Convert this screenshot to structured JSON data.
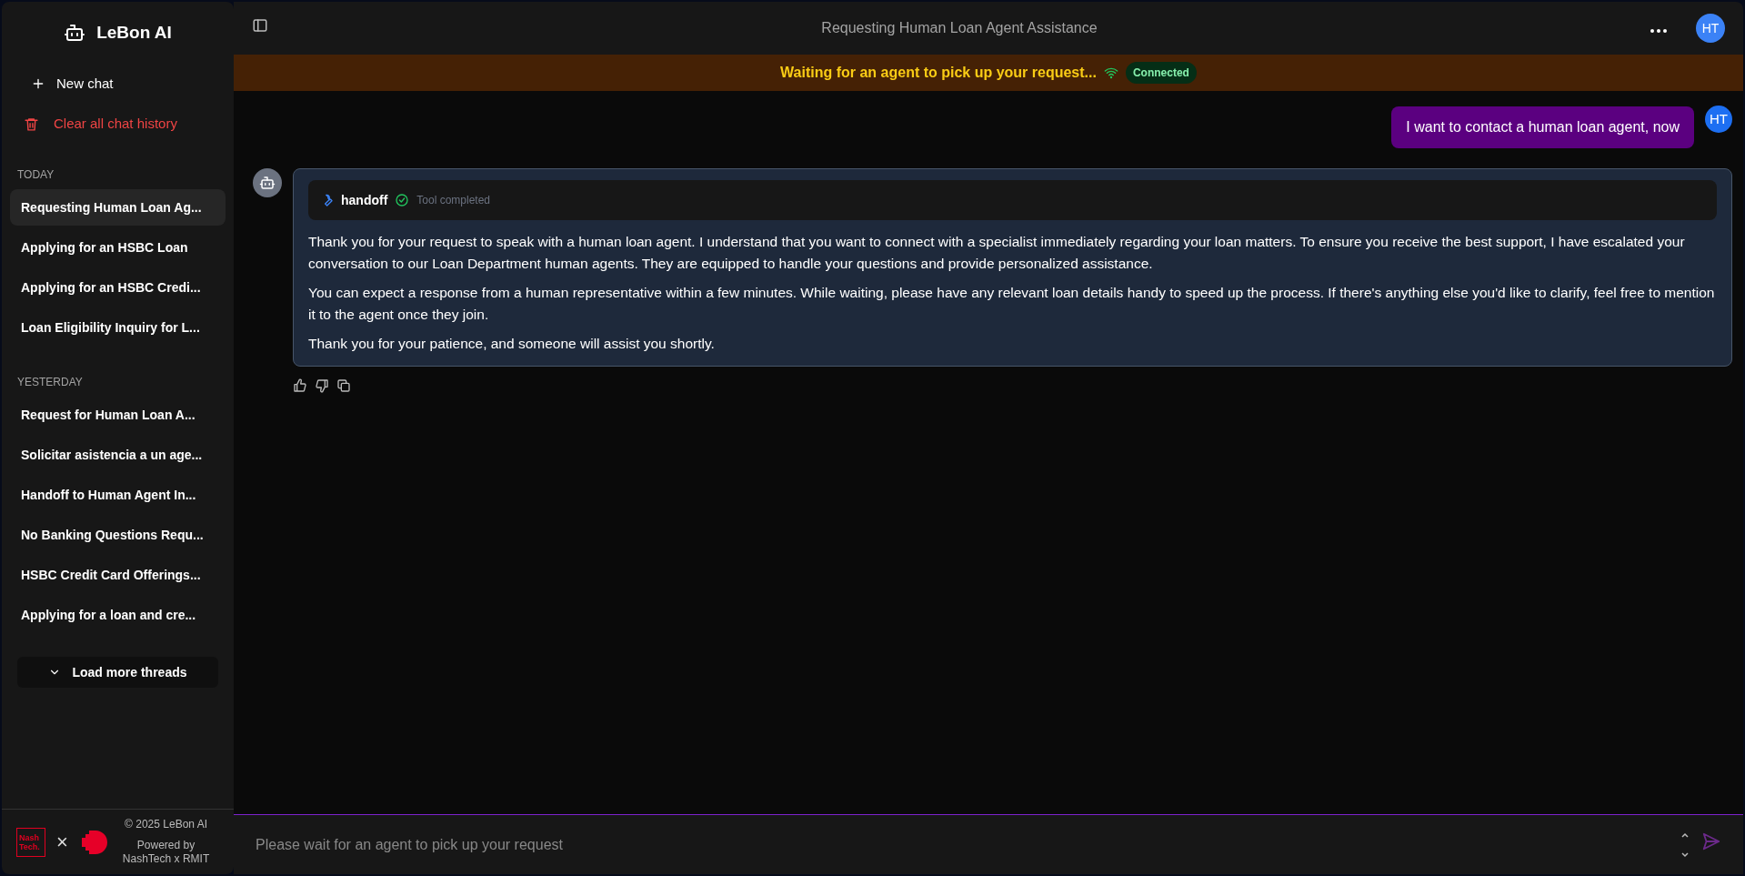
{
  "sidebar": {
    "brand": "LeBon AI",
    "actions": [
      {
        "kind": "new",
        "label": "New chat"
      },
      {
        "kind": "clear",
        "label": "Clear all chat history"
      }
    ],
    "groups": [
      {
        "label": "TODAY",
        "items": [
          {
            "title": "Requesting Human Loan Ag...",
            "selected": true
          },
          {
            "title": "Applying for an HSBC Loan",
            "selected": false
          },
          {
            "title": "Applying for an HSBC Credi...",
            "selected": false
          },
          {
            "title": "Loan Eligibility Inquiry for L...",
            "selected": false
          }
        ]
      },
      {
        "label": "YESTERDAY",
        "items": [
          {
            "title": "Request for Human Loan A...",
            "selected": false
          },
          {
            "title": "Solicitar asistencia a un age...",
            "selected": false
          },
          {
            "title": "Handoff to Human Agent In...",
            "selected": false
          },
          {
            "title": "No Banking Questions Requ...",
            "selected": false
          },
          {
            "title": "HSBC Credit Card Offerings...",
            "selected": false
          },
          {
            "title": "Applying for a loan and cre...",
            "selected": false
          }
        ]
      }
    ],
    "load_more": "Load more threads",
    "footer": {
      "logo_text": [
        "Nash",
        "Tech."
      ],
      "separator": "×",
      "copyright": "© 2025 LeBon AI",
      "powered_by": [
        "Powered by",
        "NashTech x RMIT"
      ]
    }
  },
  "header": {
    "title": "Requesting Human Loan Agent Assistance",
    "avatar": "HT"
  },
  "banner": {
    "text": "Waiting for an agent to pick up your request...",
    "status": "Connected"
  },
  "messages": [
    {
      "kind": "user",
      "avatar": "HT",
      "text": "I want to contact a human loan agent, now"
    },
    {
      "kind": "assistant",
      "tool": {
        "name": "handoff",
        "status": "Tool completed"
      },
      "paragraphs": [
        "Thank you for your request to speak with a human loan agent. I understand that you want to connect with a specialist immediately regarding your loan matters. To ensure you receive the best support, I have escalated your conversation to our Loan Department human agents. They are equipped to handle your questions and provide personalized assistance.",
        "You can expect a response from a human representative within a few minutes. While waiting, please have any relevant loan details handy to speed up the process. If there's anything else you'd like to clarify, feel free to mention it to the agent once they join.",
        "Thank you for your patience, and someone will assist you shortly."
      ]
    }
  ],
  "composer": {
    "placeholder": "Please wait for an agent to pick up your request"
  }
}
